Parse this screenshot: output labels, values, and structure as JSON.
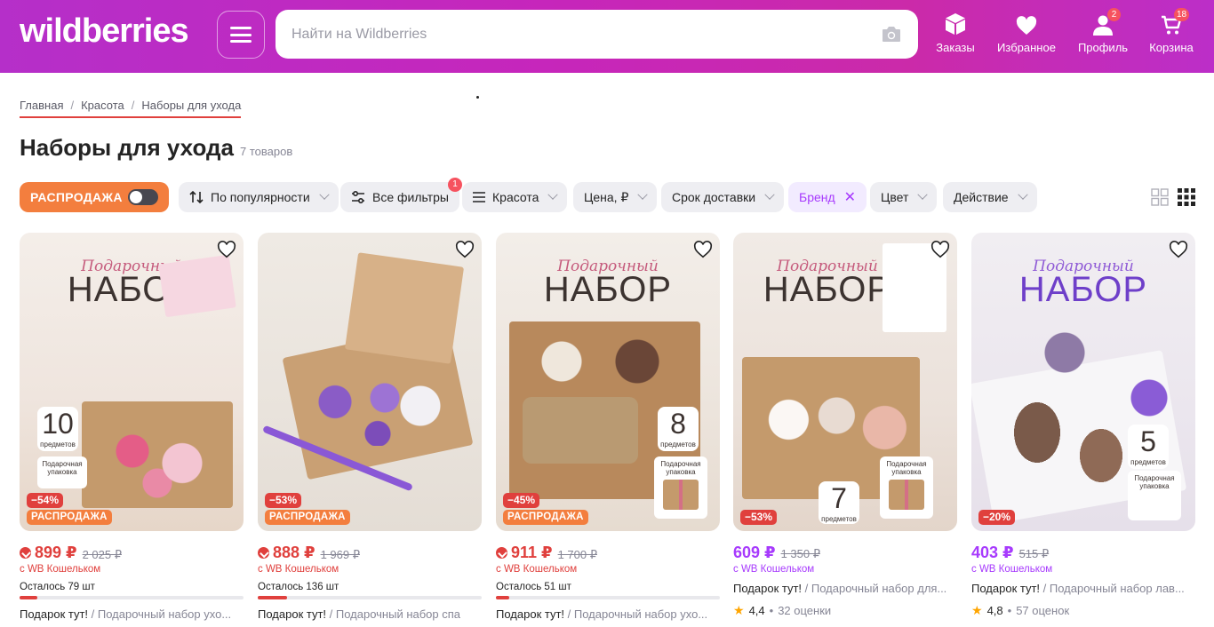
{
  "header": {
    "logo": "wildberries",
    "search_placeholder": "Найти на Wildberries",
    "nav": [
      {
        "label": "Заказы",
        "badge": ""
      },
      {
        "label": "Избранное",
        "badge": ""
      },
      {
        "label": "Профиль",
        "badge": "2"
      },
      {
        "label": "Корзина",
        "badge": "18"
      }
    ]
  },
  "breadcrumb": [
    "Главная",
    "Красота",
    "Наборы для ухода"
  ],
  "page": {
    "title": "Наборы для ухода",
    "count": "7 товаров"
  },
  "filters": {
    "sale": "РАСПРОДАЖА",
    "sort": "По популярности",
    "all": "Все фильтры",
    "all_badge": "1",
    "category": "Красота",
    "price": "Цена, ₽",
    "delivery": "Срок доставки",
    "brand": "Бренд",
    "color": "Цвет",
    "action": "Действие"
  },
  "products": [
    {
      "img_line1": "Подарочный",
      "img_line2": "НАБОР",
      "img_count": "10",
      "img_count_label": "предметов",
      "img_gift": "Подарочная упаковка",
      "discount": "−54%",
      "sale_tag": "РАСПРОДАЖА",
      "price": "899 ₽",
      "old_price": "2 025 ₽",
      "wallet": "с WB Кошельком",
      "stock": "Осталось 79 шт",
      "stock_level": 0.08,
      "gift_prefix": "Подарок тут!",
      "name": " / Подарочный набор ухо..."
    },
    {
      "discount": "−53%",
      "sale_tag": "РАСПРОДАЖА",
      "price": "888 ₽",
      "old_price": "1 969 ₽",
      "wallet": "с WB Кошельком",
      "stock": "Осталось 136 шт",
      "stock_level": 0.13,
      "gift_prefix": "Подарок тут!",
      "name": " / Подарочный набор спа"
    },
    {
      "img_line1": "Подарочный",
      "img_line2": "НАБОР",
      "img_count": "8",
      "img_count_label": "предметов",
      "img_gift": "Подарочная упаковка",
      "discount": "−45%",
      "sale_tag": "РАСПРОДАЖА",
      "price": "911 ₽",
      "old_price": "1 700 ₽",
      "wallet": "с WB Кошельком",
      "stock": "Осталось 51 шт",
      "stock_level": 0.06,
      "gift_prefix": "Подарок тут!",
      "name": " / Подарочный набор ухо..."
    },
    {
      "img_line1": "Подарочный",
      "img_line2": "НАБОР",
      "img_count": "7",
      "img_count_label": "предметов",
      "img_gift": "Подарочная упаковка",
      "discount": "−53%",
      "price": "609 ₽",
      "old_price": "1 350 ₽",
      "wallet": "с WB Кошельком",
      "gift_prefix": "Подарок тут!",
      "name": " / Подарочный набор для...",
      "rating": "4,4",
      "reviews": "32 оценки"
    },
    {
      "img_line1": "Подарочный",
      "img_line2": "НАБОР",
      "img_count": "5",
      "img_count_label": "предметов",
      "img_gift": "Подарочная упаковка",
      "discount": "−20%",
      "price": "403 ₽",
      "old_price": "515 ₽",
      "wallet": "с WB Кошельком",
      "gift_prefix": "Подарок тут!",
      "name": " / Подарочный набор лав...",
      "rating": "4,8",
      "reviews": "57 оценок"
    }
  ]
}
